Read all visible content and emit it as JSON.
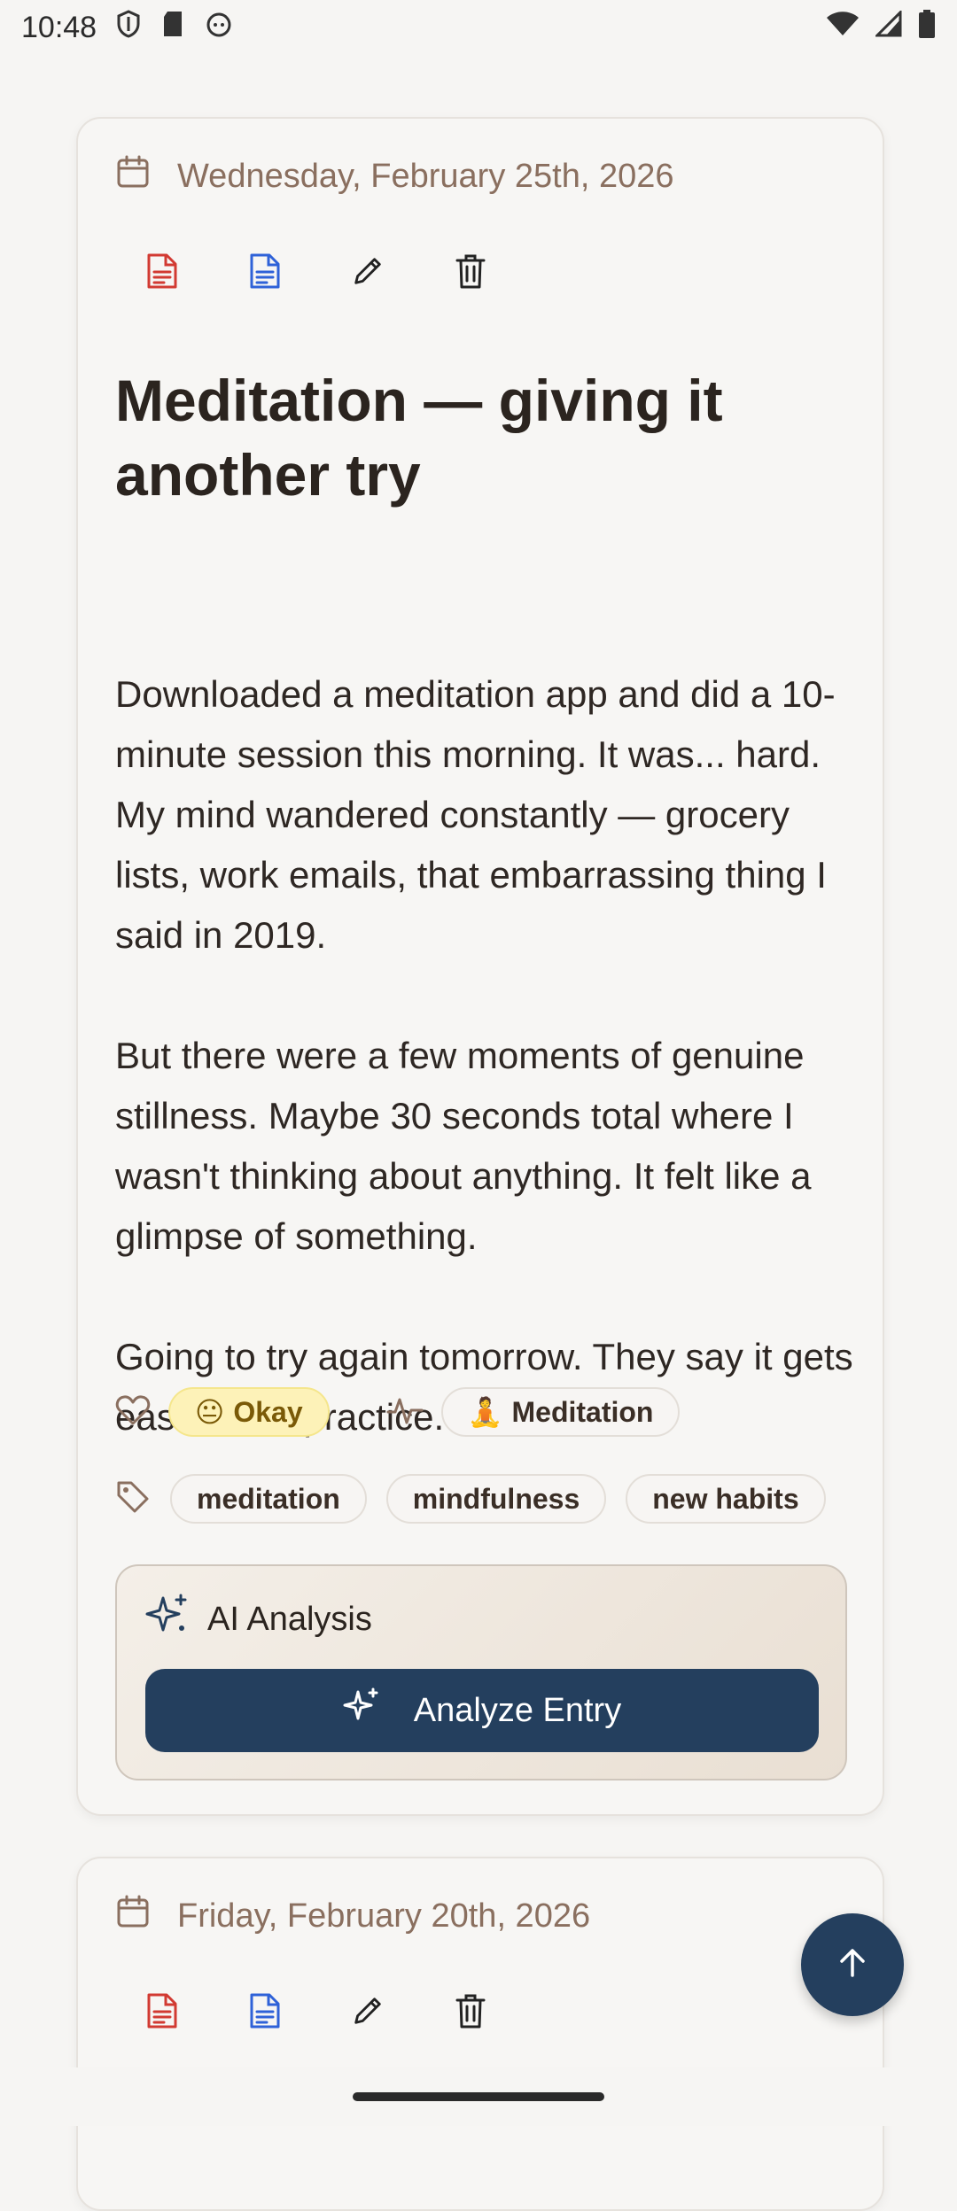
{
  "status_bar": {
    "time": "10:48"
  },
  "entries": [
    {
      "date": "Wednesday, February 25th, 2026",
      "title": "Meditation — giving it another try",
      "paragraphs": [
        "Downloaded a meditation app and did a 10-minute session this morning. It was... hard. My mind wandered constantly — grocery lists, work emails, that embarrassing thing I said in 2019.",
        "But there were a few moments of genuine stillness. Maybe 30 seconds total where I wasn't thinking about anything. It felt like a glimpse of something.",
        "Going to try again tomorrow. They say it gets easier with practice. We'll see."
      ],
      "mood": {
        "emoji": "😐",
        "label": "Okay"
      },
      "activity": {
        "emoji": "🧘",
        "label": "Meditation"
      },
      "tags": [
        "meditation",
        "mindfulness",
        "new habits"
      ],
      "ai": {
        "header": "AI Analysis",
        "button": "Analyze Entry"
      }
    },
    {
      "date": "Friday, February 20th, 2026"
    }
  ],
  "colors": {
    "primary": "#243f5e",
    "date_text": "#8a6f5f",
    "pdf_icon": "#d23a32",
    "doc_icon": "#2f62d8",
    "okay_bg": "#fdf2b8"
  }
}
